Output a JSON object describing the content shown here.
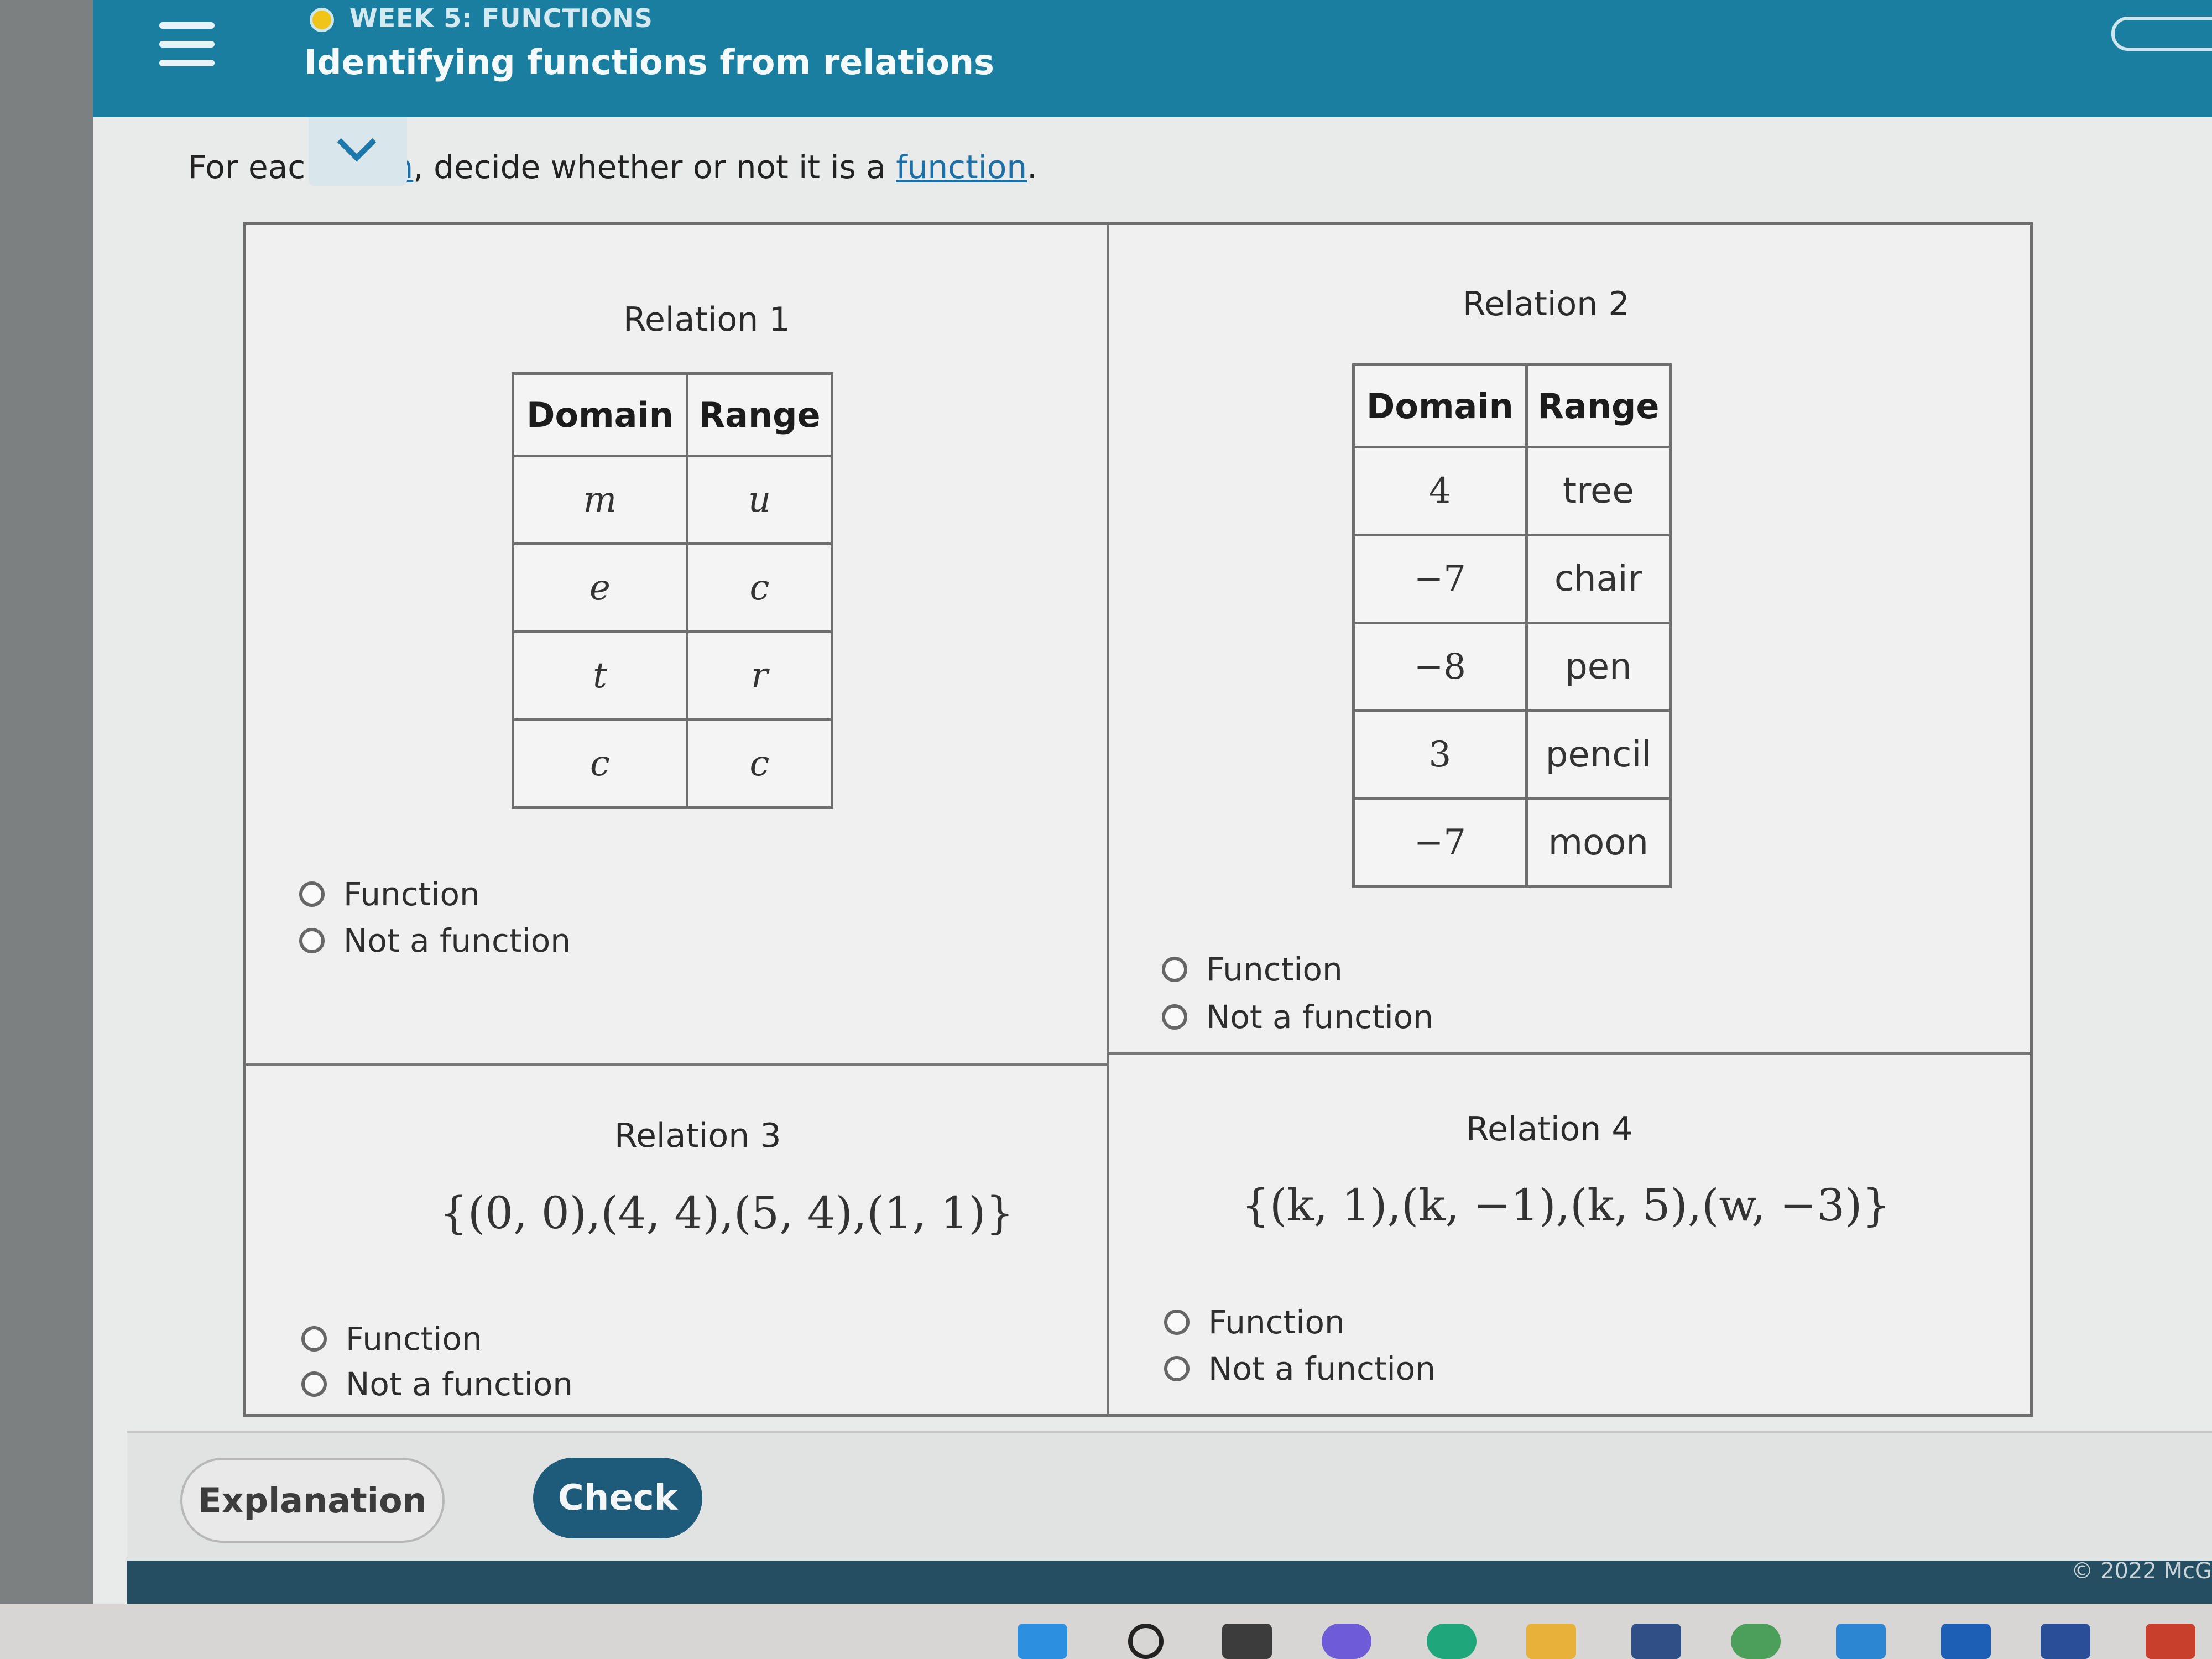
{
  "header": {
    "week_label": "WEEK 5: FUNCTIONS",
    "title": "Identifying functions from relations"
  },
  "instruction": {
    "part1": "For eac",
    "part2": "tion",
    "part3": ", decide whether or not it is a ",
    "link": "function",
    "part4": "."
  },
  "relations": [
    {
      "title": "Relation 1",
      "columns": [
        "Domain",
        "Range"
      ],
      "rows": [
        [
          "m",
          "u"
        ],
        [
          "e",
          "c"
        ],
        [
          "t",
          "r"
        ],
        [
          "c",
          "c"
        ]
      ],
      "options": [
        "Function",
        "Not a function"
      ]
    },
    {
      "title": "Relation 2",
      "columns": [
        "Domain",
        "Range"
      ],
      "rows": [
        [
          "4",
          "tree"
        ],
        [
          "−7",
          "chair"
        ],
        [
          "−8",
          "pen"
        ],
        [
          "3",
          "pencil"
        ],
        [
          "−7",
          "moon"
        ]
      ],
      "options": [
        "Function",
        "Not a function"
      ]
    },
    {
      "title": "Relation 3",
      "set": "{(0, 0),(4, 4),(5, 4),(1, 1)}",
      "options": [
        "Function",
        "Not a function"
      ]
    },
    {
      "title": "Relation 4",
      "set": "{(k, 1),(k, −1),(k, 5),(w, −3)}",
      "options": [
        "Function",
        "Not a function"
      ]
    }
  ],
  "footer": {
    "explanation_label": "Explanation",
    "check_label": "Check",
    "copyright": "© 2022 McG"
  },
  "colors": {
    "header": "#197ea0",
    "check_button": "#1e5a79",
    "link": "#1d6fa8",
    "status_dot": "#f0c419"
  },
  "taskbar_icons": [
    "start-icon",
    "search-icon",
    "task-view-icon",
    "chat-icon",
    "edge-icon",
    "file-explorer-icon",
    "store-icon",
    "chrome-icon",
    "app-icon",
    "outlook-icon",
    "word-icon",
    "office-icon"
  ]
}
